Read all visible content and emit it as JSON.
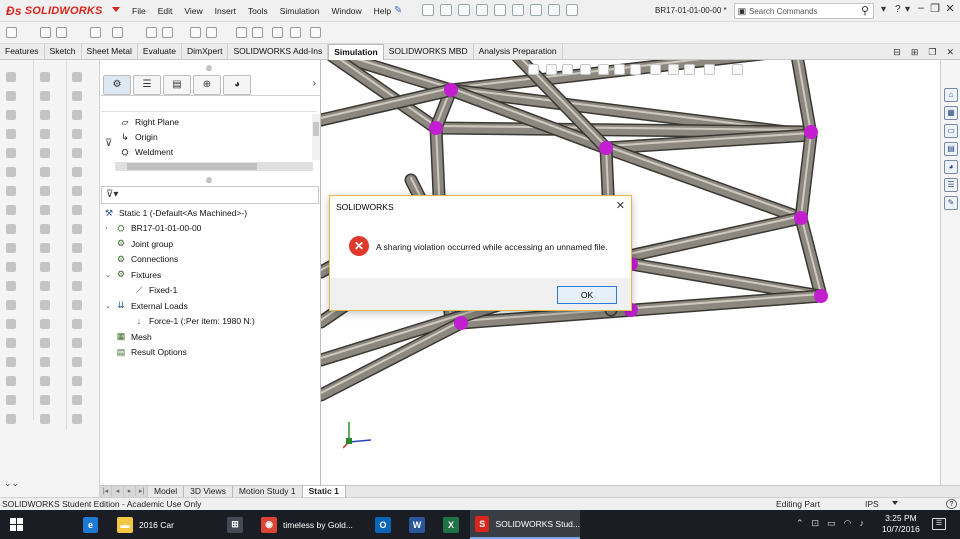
{
  "app": {
    "brand": "SOLIDWORKS",
    "menu": [
      "File",
      "Edit",
      "View",
      "Insert",
      "Tools",
      "Simulation",
      "Window",
      "Help"
    ],
    "document_title": "BR17-01-01-00-00 *",
    "search_placeholder": "Search Commands",
    "brand_color": "#d9261c"
  },
  "command_tabs": [
    {
      "label": "Features",
      "active": false
    },
    {
      "label": "Sketch",
      "active": false
    },
    {
      "label": "Sheet Metal",
      "active": false
    },
    {
      "label": "Evaluate",
      "active": false
    },
    {
      "label": "DimXpert",
      "active": false
    },
    {
      "label": "SOLIDWORKS Add-Ins",
      "active": false
    },
    {
      "label": "Simulation",
      "active": true
    },
    {
      "label": "SOLIDWORKS MBD",
      "active": false
    },
    {
      "label": "Analysis Preparation",
      "active": false
    }
  ],
  "feature_tree": {
    "top_items": [
      {
        "label": "Right Plane",
        "icon": "plane-icon"
      },
      {
        "label": "Origin",
        "icon": "origin-icon"
      },
      {
        "label": "Weldment",
        "icon": "weldment-icon"
      }
    ],
    "study": {
      "root": "Static 1 (-Default<As Machined>-)",
      "items": [
        {
          "label": "BR17-01-01-00-00",
          "icon": "part-icon",
          "expand": "›",
          "indent": 1
        },
        {
          "label": "Joint group",
          "icon": "joint-group-icon",
          "expand": "",
          "indent": 1
        },
        {
          "label": "Connections",
          "icon": "connections-icon",
          "expand": "",
          "indent": 1
        },
        {
          "label": "Fixtures",
          "icon": "fixtures-icon",
          "expand": "⌄",
          "indent": 1
        },
        {
          "label": "Fixed-1",
          "icon": "fixed-icon",
          "expand": "",
          "indent": 2
        },
        {
          "label": "External Loads",
          "icon": "external-loads-icon",
          "expand": "⌄",
          "indent": 1
        },
        {
          "label": "Force-1 (:Per item: 1980 N:)",
          "icon": "force-icon",
          "expand": "",
          "indent": 2
        },
        {
          "label": "Mesh",
          "icon": "mesh-icon",
          "expand": "",
          "indent": 1
        },
        {
          "label": "Result Options",
          "icon": "result-options-icon",
          "expand": "",
          "indent": 1
        }
      ]
    }
  },
  "bottom_tabs": [
    {
      "label": "Model",
      "active": false
    },
    {
      "label": "3D Views",
      "active": false
    },
    {
      "label": "Motion Study 1",
      "active": false
    },
    {
      "label": "Static 1",
      "active": true
    }
  ],
  "status": {
    "left": "SOLIDWORKS Student Edition - Academic Use Only",
    "mode": "Editing Part",
    "units": "IPS",
    "help": "?"
  },
  "dialog": {
    "title": "SOLIDWORKS",
    "message": "A sharing violation occurred while accessing an unnamed file.",
    "ok_label": "OK",
    "error_icon": "error-icon",
    "accent_color": "#e7b74a"
  },
  "taskbar": {
    "apps": [
      {
        "label": "",
        "icon": "edge-icon",
        "color": "#1e78d4"
      },
      {
        "label": "2016 Car",
        "icon": "folder-icon",
        "color": "#f2c744"
      },
      {
        "label": "",
        "icon": "store-icon",
        "color": "#444a55"
      },
      {
        "label": "timeless by Gold...",
        "icon": "chrome-icon",
        "color": "#db4437"
      },
      {
        "label": "",
        "icon": "outlook-icon",
        "color": "#0a64b8"
      },
      {
        "label": "",
        "icon": "word-icon",
        "color": "#2b579a"
      },
      {
        "label": "",
        "icon": "excel-icon",
        "color": "#217346"
      },
      {
        "label": "SOLIDWORKS Stud...",
        "icon": "solidworks-icon",
        "color": "#d9261c"
      }
    ],
    "clock_time": "3:25 PM",
    "clock_date": "10/7/2016"
  },
  "model": {
    "tube_color": "#8c887f",
    "node_color": "#c21fd1"
  }
}
